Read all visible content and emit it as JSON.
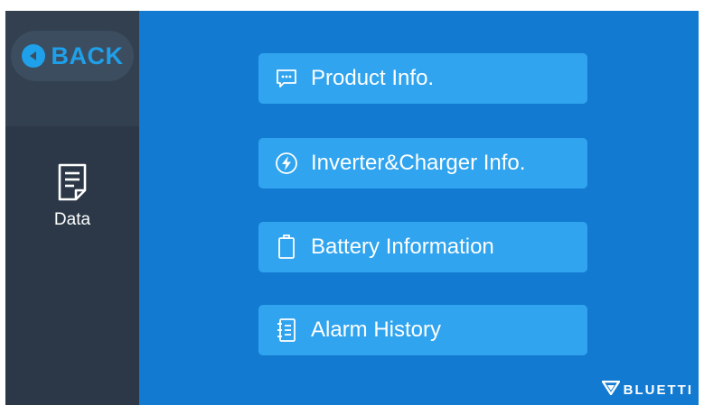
{
  "sidebar": {
    "back_label": "BACK",
    "back_icon": "back-arrow-icon",
    "current": {
      "label": "Data",
      "icon": "data-document-icon"
    }
  },
  "menu": {
    "items": [
      {
        "label": "Product Info.",
        "icon": "chat-bubble-icon"
      },
      {
        "label": "Inverter&Charger Info.",
        "icon": "lightning-icon"
      },
      {
        "label": "Battery Information",
        "icon": "battery-icon"
      },
      {
        "label": "Alarm History",
        "icon": "notebook-icon"
      }
    ]
  },
  "brand": {
    "logo_text": "BLUETTI"
  },
  "colors": {
    "sidebar": "#2c3847",
    "main": "#127bd1",
    "button": "#30a4ee",
    "accent": "#1ea0ea"
  }
}
